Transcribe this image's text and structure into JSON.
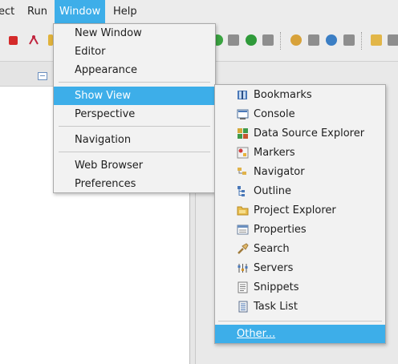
{
  "menubar": {
    "items": [
      {
        "label": "ect",
        "active": false
      },
      {
        "label": "Run",
        "active": false
      },
      {
        "label": "Window",
        "active": true
      },
      {
        "label": "Help",
        "active": false
      }
    ]
  },
  "window_menu": {
    "items": [
      {
        "label": "New Window"
      },
      {
        "label": "Editor"
      },
      {
        "label": "Appearance"
      },
      {
        "label": "Show View",
        "highlighted": true
      },
      {
        "label": "Perspective"
      },
      {
        "label": "Navigation"
      },
      {
        "label": "Web Browser"
      },
      {
        "label": "Preferences"
      }
    ]
  },
  "show_view_menu": {
    "items": [
      {
        "label": "Bookmarks",
        "icon": "bookmarks-icon"
      },
      {
        "label": "Console",
        "icon": "console-icon"
      },
      {
        "label": "Data Source Explorer",
        "icon": "data-source-explorer-icon"
      },
      {
        "label": "Markers",
        "icon": "markers-icon"
      },
      {
        "label": "Navigator",
        "icon": "navigator-icon"
      },
      {
        "label": "Outline",
        "icon": "outline-icon"
      },
      {
        "label": "Project Explorer",
        "icon": "project-explorer-icon"
      },
      {
        "label": "Properties",
        "icon": "properties-icon"
      },
      {
        "label": "Search",
        "icon": "search-icon"
      },
      {
        "label": "Servers",
        "icon": "servers-icon"
      },
      {
        "label": "Snippets",
        "icon": "snippets-icon"
      },
      {
        "label": "Task List",
        "icon": "task-list-icon"
      }
    ],
    "other_label": "Other..."
  },
  "colors": {
    "accent": "#3daee9",
    "menu_bg": "#f2f2f2",
    "chrome_bg": "#ececec"
  }
}
